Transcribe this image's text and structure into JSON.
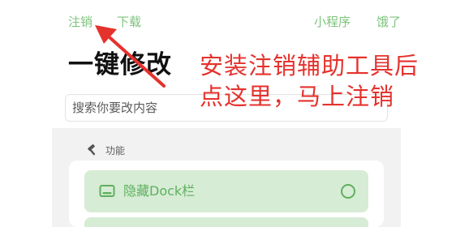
{
  "nav": {
    "logout_label": "注销",
    "download_label": "下载",
    "mini_program_label": "小程序",
    "hungry_label": "饿了"
  },
  "page_title": "一键修改",
  "search": {
    "placeholder": "搜索你要改内容"
  },
  "section": {
    "icon": "hammer-icon",
    "title": "功能"
  },
  "features": [
    {
      "icon": "dock-icon",
      "label": "隐藏Dock栏",
      "enabled": false
    }
  ],
  "annotation": {
    "line1": "安装注销辅助工具后",
    "line2": "点这里，马上注销",
    "color": "#e5322d"
  },
  "colors": {
    "accent_green": "#7cc37c",
    "item_bg": "#d6ecd4",
    "item_text": "#5fb05f",
    "gray_area": "#f2f2f2"
  }
}
